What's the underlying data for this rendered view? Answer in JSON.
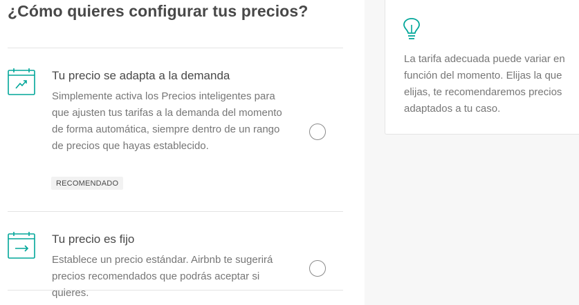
{
  "page": {
    "title": "¿Cómo quieres configurar tus precios?"
  },
  "options": [
    {
      "title": "Tu precio se adapta a la demanda",
      "description": "Simplemente activa los Precios inteligentes para que ajusten tus tarifas a la demanda del momento de forma automática, siempre dentro de un rango de precios que hayas establecido.",
      "badge": "RECOMENDADO",
      "icon": "calendar-trend-icon",
      "selected": false
    },
    {
      "title": "Tu precio es fijo",
      "description": "Establece un precio estándar. Airbnb te sugerirá precios recomendados que podrás aceptar si quieres.",
      "icon": "calendar-arrow-icon",
      "selected": false
    }
  ],
  "tip": {
    "icon": "lightbulb-icon",
    "text": "La tarifa adecuada puede variar en función del momento. Elijas la que elijas, te recomendaremos precios adaptados a tu caso."
  },
  "colors": {
    "accent": "#00a699",
    "text": "#484848",
    "muted": "#767676",
    "divider": "#e4e4e4",
    "panel_bg": "#f7f7f7"
  }
}
